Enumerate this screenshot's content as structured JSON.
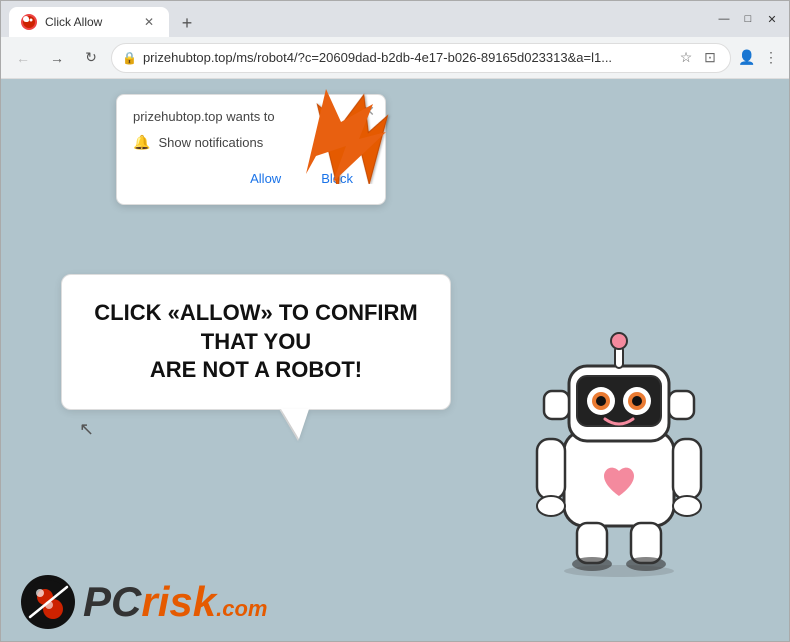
{
  "browser": {
    "tab": {
      "title": "Click Allow",
      "favicon": "circle-icon"
    },
    "new_tab_label": "+",
    "controls": {
      "minimize": "—",
      "maximize": "□",
      "close": "✕"
    },
    "nav": {
      "back": "←",
      "forward": "→",
      "refresh": "↻",
      "url": "prizehubtop.top/ms/robot4/?c=20609dad-b2db-4e17-b026-89165d023313&a=l1...",
      "lock_icon": "🔒"
    },
    "address_icons": [
      "⊕",
      "☆",
      "☰",
      "👤",
      "⋮"
    ]
  },
  "notification_popup": {
    "title": "prizehubtop.top wants to",
    "notification_label": "Show notifications",
    "allow_btn": "Allow",
    "block_btn": "Block",
    "close_icon": "✕"
  },
  "speech_bubble": {
    "line1": "CLICK «ALLOW» TO CONFIRM THAT YOU",
    "line2": "ARE NOT A ROBOT!"
  },
  "pcrisk": {
    "text_pc": "PC",
    "text_risk": "risk",
    "dot_com": ".com"
  },
  "colors": {
    "background": "#b0c4cc",
    "accent_orange": "#e55a00",
    "bubble_bg": "#ffffff",
    "popup_bg": "#ffffff"
  }
}
